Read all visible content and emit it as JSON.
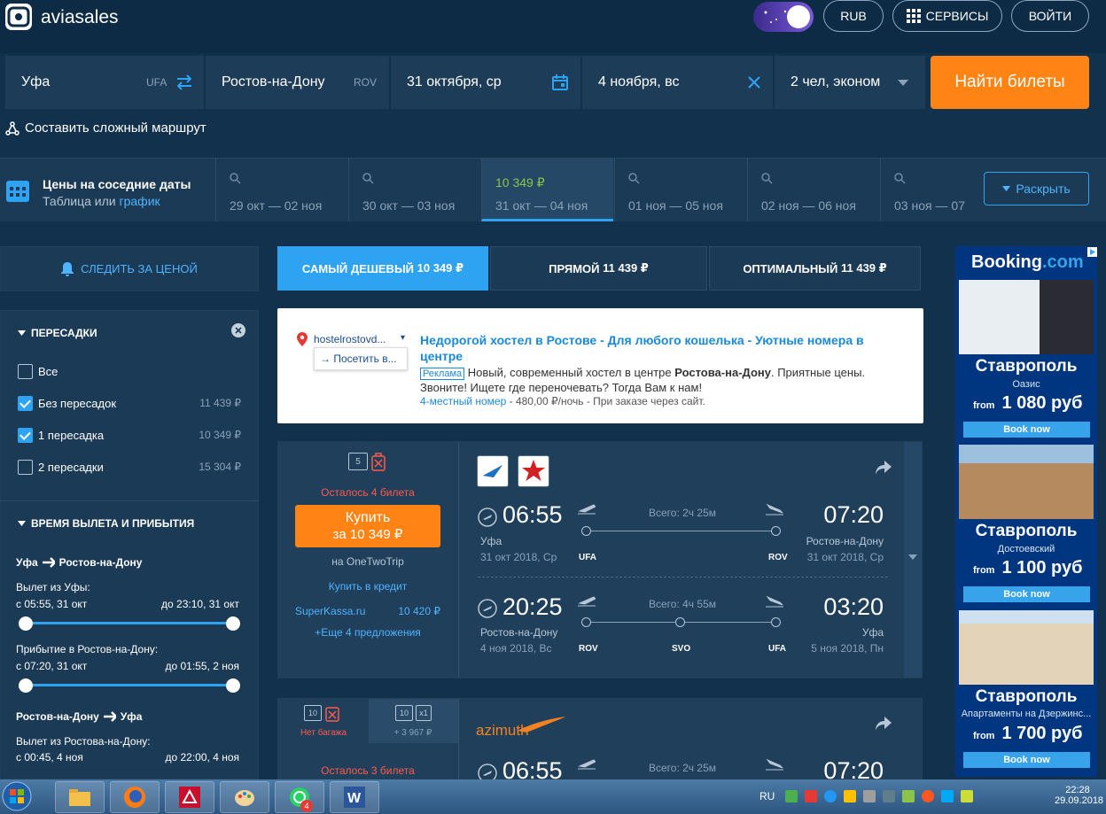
{
  "header": {
    "logo_text": "aviasales",
    "currency": "RUB",
    "services": "СЕРВИСЫ",
    "login": "ВОЙТИ"
  },
  "search": {
    "origin": "Уфа",
    "origin_code": "UFA",
    "destination": "Ростов-на-Дону",
    "destination_code": "ROV",
    "depart_date": "31 октября, ср",
    "return_date": "4 ноября, вс",
    "passengers": "2 чел, эконом",
    "find_button": "Найти билеты",
    "complex_route": "Составить сложный маршрут"
  },
  "nearby_dates": {
    "title": "Цены на соседние даты",
    "subtitle_prefix": "Таблица",
    "subtitle_or": "или",
    "subtitle_link": "график",
    "cells": [
      {
        "range": "29 окт — 02 ноя",
        "price": ""
      },
      {
        "range": "30 окт — 03 ноя",
        "price": ""
      },
      {
        "range": "31 окт — 04 ноя",
        "price": "10 349 ₽"
      },
      {
        "range": "01 ноя — 05 ноя",
        "price": ""
      },
      {
        "range": "02 ноя — 06 ноя",
        "price": ""
      },
      {
        "range": "03 ноя — 07",
        "price": ""
      }
    ],
    "expand": "Раскрыть"
  },
  "watch_price": "СЛЕДИТЬ ЗА ЦЕНОЙ",
  "sort_tabs": [
    {
      "label": "САМЫЙ ДЕШЕВЫЙ",
      "price": "10 349 ₽"
    },
    {
      "label": "ПРЯМОЙ",
      "price": "11 439 ₽"
    },
    {
      "label": "ОПТИМАЛЬНЫЙ",
      "price": "11 439 ₽"
    }
  ],
  "filters": {
    "stops_title": "ПЕРЕСАДКИ",
    "stops": [
      {
        "label": "Все",
        "price": "",
        "checked": false
      },
      {
        "label": "Без пересадок",
        "price": "11 439 ₽",
        "checked": true
      },
      {
        "label": "1 пересадка",
        "price": "10 349 ₽",
        "checked": true
      },
      {
        "label": "2 пересадки",
        "price": "15 304 ₽",
        "checked": false
      }
    ],
    "time_title": "ВРЕМЯ ВЫЛЕТА И ПРИБЫТИЯ",
    "outbound_route_from": "Уфа",
    "outbound_route_to": "Ростов-на-Дону",
    "dep_label_1": "Вылет из Уфы:",
    "dep_from_1": "с 05:55, 31 окт",
    "dep_to_1": "до 23:10, 31 окт",
    "arr_label_1": "Прибытие в Ростов-на-Дону:",
    "arr_from_1": "с 07:20, 31 окт",
    "arr_to_1": "до 01:55, 2 ноя",
    "return_route_from": "Ростов-на-Дону",
    "return_route_to": "Уфа",
    "dep_label_2": "Вылет из Ростова-на-Дону:",
    "dep_from_2": "с 00:45, 4 ноя",
    "dep_to_2": "до 22:00, 4 ноя"
  },
  "ad": {
    "domain": "hostelrostovd...",
    "visit": "→ Посетить в...",
    "title": "Недорогой хостел в Ростове - Для любого кошелька - Уютные номера в центре",
    "badge": "Реклама",
    "desc_1": "Новый, современный хостел в центре",
    "desc_bold": "Ростова-на-Дону",
    "desc_2": ". Приятные цены.",
    "desc_3": "Звоните! Ищете где переночевать? Тогда Вам к нам!",
    "link": "4-местный номер",
    "link_rest": "- 480,00 ₽/ночь - При заказе через сайт."
  },
  "ticket1": {
    "baggage_count": "5",
    "remaining": "Осталось 4 билета",
    "buy": "Купить",
    "buy_price": "за 10 349 ₽",
    "seller": "на OneTwoTrip",
    "credit": "Купить в кредит",
    "alt_seller": "SuperKassa.ru",
    "alt_price": "10 420 ₽",
    "more": "+Еще 4 предложения",
    "out": {
      "dep_time": "06:55",
      "dep_city": "Уфа",
      "dep_date": "31 окт 2018, Ср",
      "arr_time": "07:20",
      "arr_city": "Ростов-на-Дону",
      "arr_date": "31 окт 2018, Ср",
      "duration": "Всего: 2ч 25м",
      "from_code": "UFA",
      "to_code": "ROV"
    },
    "ret": {
      "dep_time": "20:25",
      "dep_city": "Ростов-на-Дону",
      "dep_date": "4 ноя 2018, Вс",
      "arr_time": "03:20",
      "arr_city": "Уфа",
      "arr_date": "5 ноя 2018, Пн",
      "duration": "Всего: 4ч 55м",
      "from_code": "ROV",
      "via_code": "SVO",
      "to_code": "UFA"
    }
  },
  "ticket2": {
    "no_bag_count": "10",
    "no_bag": "Нет багажа",
    "bag_count": "10",
    "bag_extra": "x1",
    "bag_price": "+ 3 967 ₽",
    "airline": "azimuth",
    "remaining": "Осталось 3 билета",
    "dep_time": "06:55",
    "duration": "Всего: 2ч 25м",
    "arr_time": "07:20"
  },
  "booking_ad": {
    "brand": "Booking",
    "brand_tld": ".com",
    "items": [
      {
        "city": "Ставрополь",
        "hotel": "Оазис",
        "from": "from",
        "price": "1 080 руб",
        "button": "Book now"
      },
      {
        "city": "Ставрополь",
        "hotel": "Достоевский",
        "from": "from",
        "price": "1 100 руб",
        "button": "Book now"
      },
      {
        "city": "Ставрополь",
        "hotel": "Апартаменты на Дзержинс...",
        "from": "from",
        "price": "1 700 руб",
        "button": "Book now"
      }
    ]
  },
  "taskbar": {
    "lang": "RU",
    "time": "22:28",
    "date": "29.09.2018",
    "badge": "4"
  },
  "colors": {
    "accent_orange": "#ff8414",
    "active_tab": "#2ea3f2",
    "link_blue": "#4fb3ff",
    "price_green": "#8bc34a",
    "warning_red": "#ff5a4a"
  }
}
